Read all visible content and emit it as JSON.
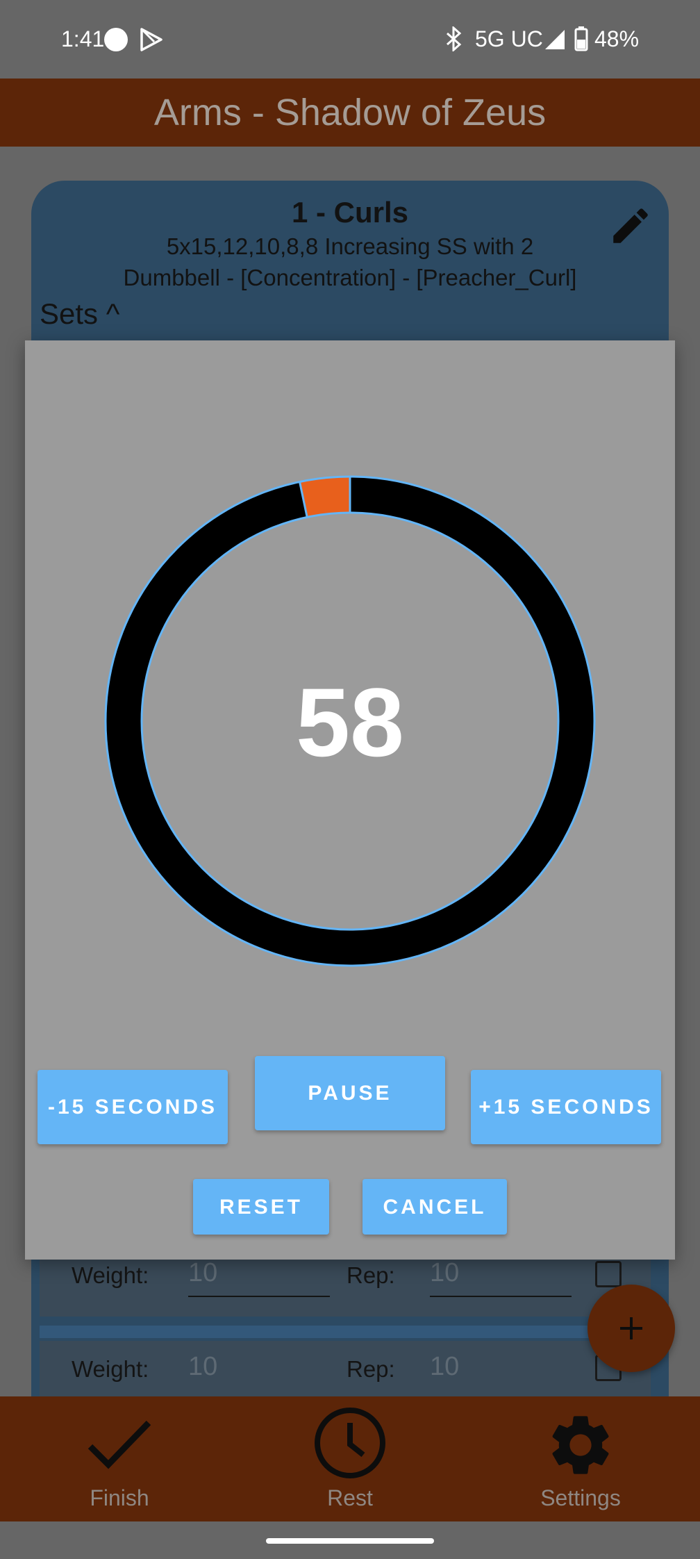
{
  "status_bar": {
    "time": "1:41",
    "network": "5G UC",
    "battery": "48%"
  },
  "app_bar": {
    "title": "Arms - Shadow of Zeus"
  },
  "exercise_card": {
    "title": "1 - Curls",
    "scheme": "5x15,12,10,8,8 Increasing SS with 2",
    "equipment": "Dumbbell - [Concentration] - [Preacher_Curl]",
    "sets_toggle": "Sets ^",
    "rows": [
      {
        "weight_label": "Weight:",
        "weight_value": "10",
        "rep_label": "Rep:",
        "rep_value": "10"
      },
      {
        "weight_label": "Weight:",
        "weight_value": "10",
        "rep_label": "Rep:",
        "rep_value": "10"
      }
    ]
  },
  "timer_dialog": {
    "count": "58",
    "elapsed_fraction": 0.033,
    "buttons": {
      "minus": "-15 SECONDS",
      "pause": "PAUSE",
      "plus": "+15 SECONDS",
      "reset": "RESET",
      "cancel": "CANCEL"
    }
  },
  "bottom_nav": {
    "items": [
      {
        "label": "Finish",
        "icon": "checkmark-icon"
      },
      {
        "label": "Rest",
        "icon": "clock-icon"
      },
      {
        "label": "Settings",
        "icon": "gear-icon"
      }
    ]
  },
  "colors": {
    "app_bar": "#5c2508",
    "card": "#2c4a63",
    "dialog": "#9b9b9b",
    "button": "#64b5f6",
    "ring_track": "#000000",
    "ring_progress": "#e8601c",
    "ring_outline": "#64b5f6"
  }
}
